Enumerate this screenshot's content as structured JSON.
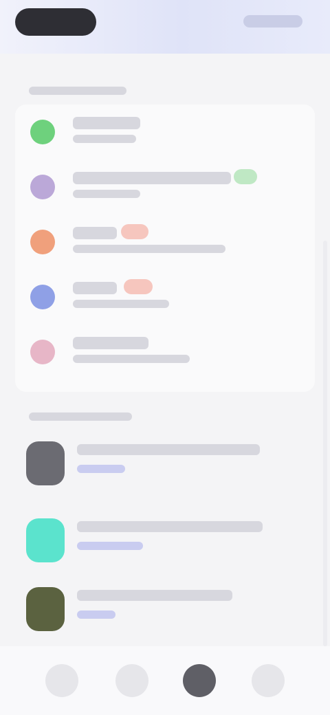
{
  "header": {
    "title": "",
    "action_label": ""
  },
  "sections": {
    "apps_label": "",
    "feed_label": ""
  },
  "colors": {
    "accent": "#7d83d9",
    "green": "#6ed17d",
    "purple": "#bba8d8",
    "orange": "#f0a07c",
    "blue": "#8fa0e6",
    "pink": "#e7b6c7",
    "teal": "#5be3cd",
    "olive": "#5b6240",
    "gray": "#6b6b72"
  },
  "apps": [
    {
      "icon": "leaf-icon",
      "title": "",
      "subtitle": ""
    },
    {
      "icon": "grid-icon",
      "title": "",
      "subtitle": ""
    },
    {
      "icon": "fire-icon",
      "title": "",
      "subtitle": ""
    },
    {
      "icon": "drop-icon",
      "title": "",
      "subtitle": ""
    },
    {
      "icon": "heart-icon",
      "title": "",
      "subtitle": ""
    }
  ],
  "feed": [
    {
      "thumb": "avatar-gray",
      "title": "",
      "link": ""
    },
    {
      "thumb": "avatar-teal",
      "title": "",
      "link": ""
    },
    {
      "thumb": "avatar-olive",
      "title": "",
      "link": ""
    }
  ],
  "tabs": [
    {
      "icon": "home-icon"
    },
    {
      "icon": "compass-icon"
    },
    {
      "icon": "profile-icon"
    },
    {
      "icon": "more-icon"
    }
  ]
}
